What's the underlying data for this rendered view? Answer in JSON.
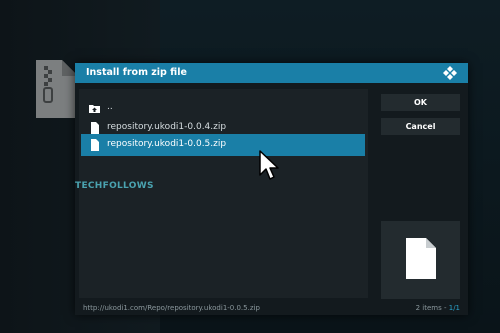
{
  "dialog": {
    "title": "Install from zip file",
    "logo_icon": "kodi-logo-icon"
  },
  "file_list": {
    "items": [
      {
        "label": "..",
        "icon": "folder-up-icon",
        "selected": false
      },
      {
        "label": "repository.ukodi1-0.0.4.zip",
        "icon": "file-icon",
        "selected": false
      },
      {
        "label": "repository.ukodi1-0.0.5.zip",
        "icon": "file-icon",
        "selected": true
      }
    ]
  },
  "buttons": {
    "ok": "OK",
    "cancel": "Cancel"
  },
  "preview": {
    "icon": "file-icon"
  },
  "footer": {
    "path": "http://ukodi1.com/Repo/repository.ukodi1-0.0.5.zip",
    "count": "2 items - ",
    "page": "1/1"
  },
  "watermark": "TECHFOLLOWS",
  "colors": {
    "accent": "#1a7fa7",
    "dialog_bg": "#131a1e",
    "panel_bg": "#1b2226",
    "button_bg": "#232b2f"
  }
}
